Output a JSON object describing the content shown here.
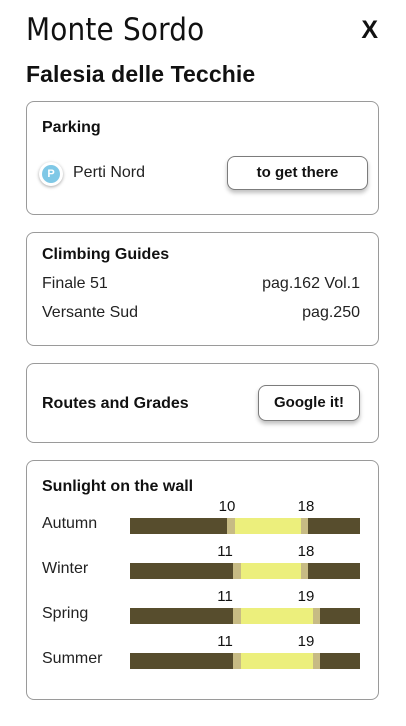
{
  "header": {
    "crag_name": "Monte Sordo",
    "close_label": "X",
    "sector_title": "Falesia delle Tecchie"
  },
  "parking": {
    "title": "Parking",
    "icon_letter": "P",
    "name": "Perti Nord",
    "directions_label": "to get there"
  },
  "guides": {
    "title": "Climbing Guides",
    "items": [
      {
        "name": "Finale 51",
        "page": "pag.162 Vol.1"
      },
      {
        "name": "Versante Sud",
        "page": "pag.250"
      }
    ]
  },
  "routes": {
    "title": "Routes and Grades",
    "search_label": "Google it!"
  },
  "sunlight": {
    "title": "Sunlight on the wall",
    "seasons": [
      {
        "name": "Autumn",
        "start": "10",
        "end": "18"
      },
      {
        "name": "Winter",
        "start": "11",
        "end": "18"
      },
      {
        "name": "Spring",
        "start": "11",
        "end": "19"
      },
      {
        "name": "Summer",
        "start": "11",
        "end": "19"
      }
    ]
  },
  "colors": {
    "shade": "#574d2d",
    "sun": "#ecef7c",
    "transition": "#c7bb84",
    "parking_icon": "#7fc8e6"
  }
}
